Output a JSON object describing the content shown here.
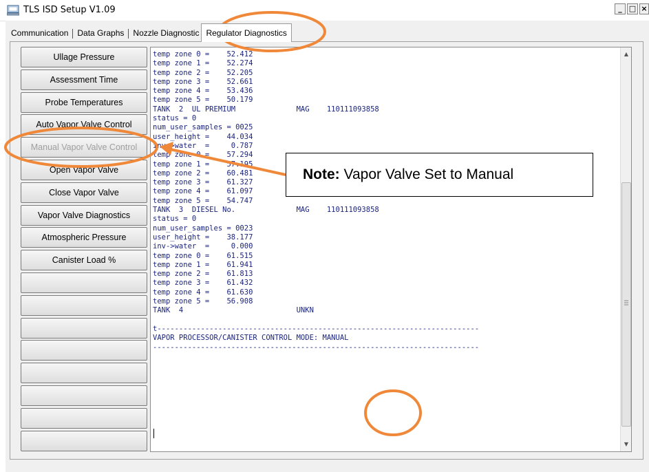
{
  "window": {
    "title": "TLS ISD Setup V1.09",
    "minimize": "_",
    "maximize": "□",
    "close": "×"
  },
  "tabs": [
    {
      "label": "Communication"
    },
    {
      "label": "Data Graphs"
    },
    {
      "label": "Nozzle Diagnostic"
    },
    {
      "label": "Regulator Diagnostics",
      "active": true
    }
  ],
  "buttons": [
    {
      "label": "Ullage Pressure"
    },
    {
      "label": "Assessment Time"
    },
    {
      "label": "Probe Temperatures"
    },
    {
      "label": "Auto Vapor Valve Control"
    },
    {
      "label": "Manual Vapor Valve Control",
      "disabled": true
    },
    {
      "label": "Open Vapor Valve"
    },
    {
      "label": "Close Vapor Valve"
    },
    {
      "label": "Vapor Valve Diagnostics"
    },
    {
      "label": "Atmospheric Pressure"
    },
    {
      "label": "Canister Load %"
    },
    {
      "label": ""
    },
    {
      "label": ""
    },
    {
      "label": ""
    },
    {
      "label": ""
    },
    {
      "label": ""
    },
    {
      "label": ""
    },
    {
      "label": ""
    },
    {
      "label": ""
    }
  ],
  "output_lines": [
    "temp zone 0 =    52.412",
    "temp zone 1 =    52.274",
    "temp zone 2 =    52.205",
    "temp zone 3 =    52.661",
    "temp zone 4 =    53.436",
    "temp zone 5 =    50.179",
    "TANK  2  UL PREMIUM              MAG    110111093858",
    "status = 0",
    "num_user_samples = 0025",
    "user_height =    44.034",
    "inv->water  =     0.787",
    "temp zone 0 =    57.294",
    "temp zone 1 =    57.195",
    "temp zone 2 =    60.481",
    "temp zone 3 =    61.327",
    "temp zone 4 =    61.097",
    "temp zone 5 =    54.747",
    "TANK  3  DIESEL No.              MAG    110111093858",
    "status = 0",
    "num_user_samples = 0023",
    "user_height =    38.177",
    "inv->water  =     0.000",
    "temp zone 0 =    61.515",
    "temp zone 1 =    61.941",
    "temp zone 2 =    61.813",
    "temp zone 3 =    61.432",
    "temp zone 4 =    61.630",
    "temp zone 5 =    56.908",
    "TANK  4                          UNKN",
    "",
    "t--------------------------------------------------------------------------",
    "VAPOR PROCESSOR/CANISTER CONTROL MODE: MANUAL",
    "---------------------------------------------------------------------------"
  ],
  "scrollbar": {
    "up_arrow": "▲",
    "down_arrow": "▼"
  },
  "annotation": {
    "note_label": "Note:",
    "note_text": " Vapor Valve Set to Manual",
    "highlight_color": "#f0883a"
  }
}
